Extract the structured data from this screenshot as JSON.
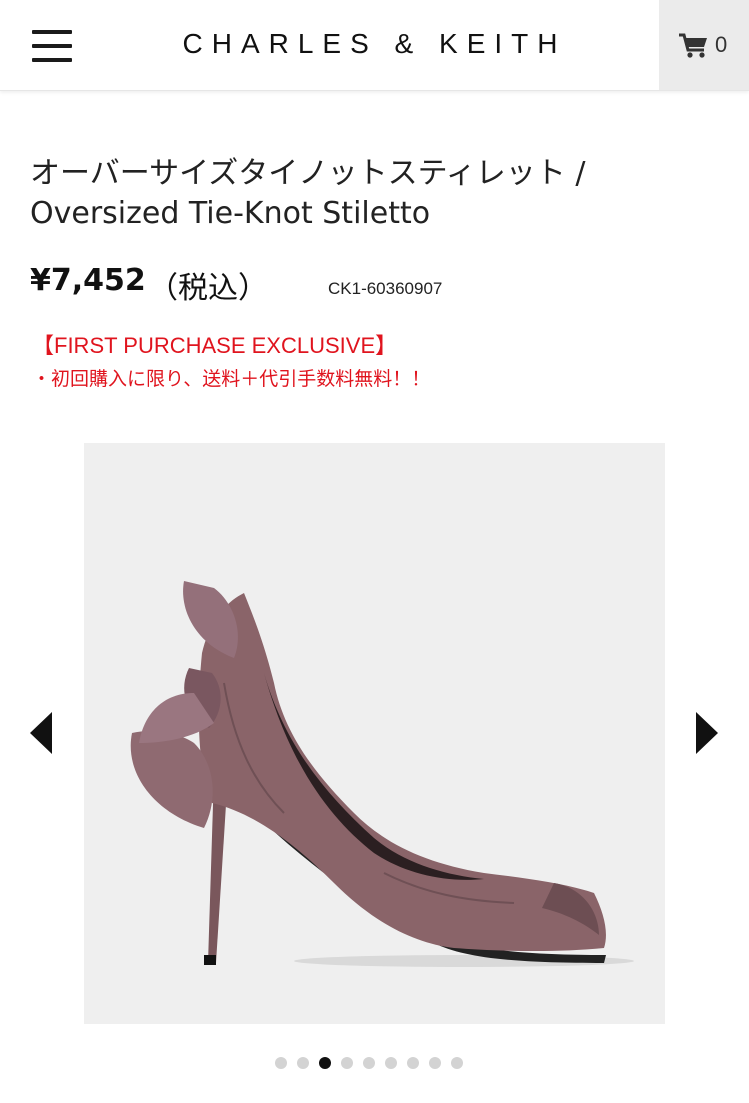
{
  "header": {
    "brand": "CHARLES & KEITH",
    "cart_count": "0",
    "menu_icon": "hamburger-menu-icon",
    "cart_icon": "shopping-cart-icon"
  },
  "product": {
    "title_ja": "オーバーサイズタイノットスティレット /",
    "title_en": "Oversized Tie-Knot Stiletto",
    "price": "¥7,452",
    "tax_label": "（税込）",
    "sku": "CK1-60360907"
  },
  "promo": {
    "title": "【FIRST PURCHASE EXCLUSIVE】",
    "note": "・初回購入に限り、送料＋代引手数料無料！！"
  },
  "gallery": {
    "total_slides": 9,
    "active_index": 2,
    "prev_icon": "chevron-left-icon",
    "next_icon": "chevron-right-icon"
  },
  "colors": {
    "promo": "#e0141e",
    "shoe": "#8a6469",
    "image_bg": "#efefef",
    "cart_bg": "#ebebeb"
  }
}
